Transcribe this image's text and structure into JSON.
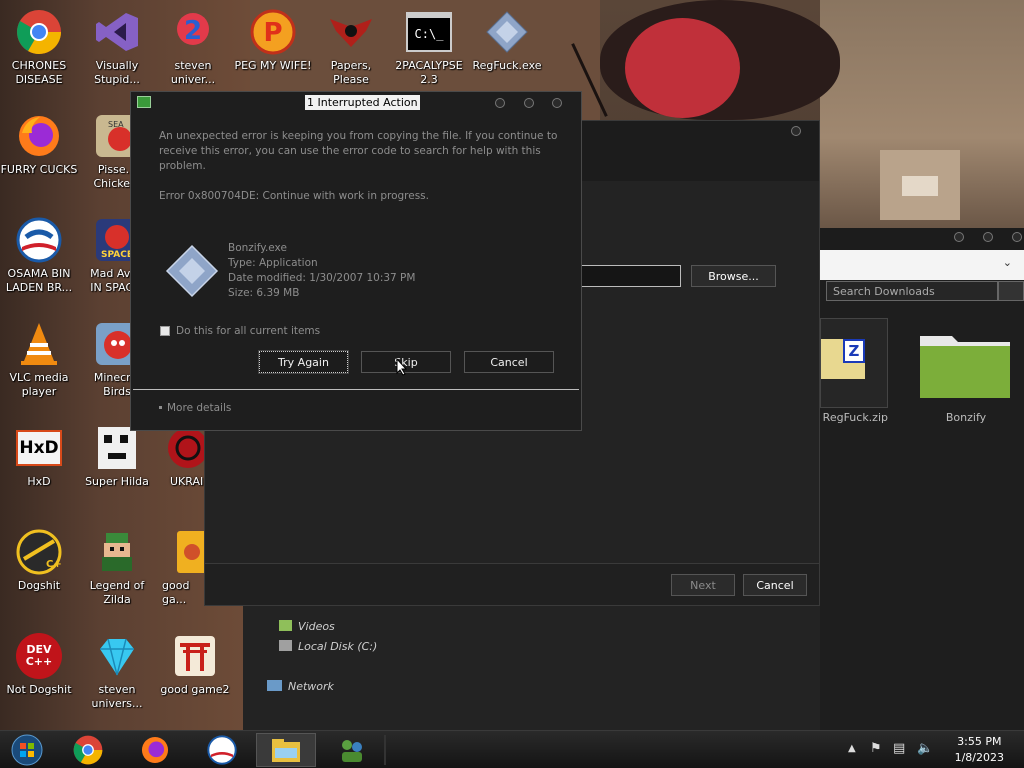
{
  "desktop_icons": [
    {
      "label": "CHRONES\nDISEASE",
      "icon": "chrome-icon"
    },
    {
      "label": "Visually\nStupid...",
      "icon": "visual-studio-icon"
    },
    {
      "label": "steven\nuniver...",
      "icon": "steven-universe-icon"
    },
    {
      "label": "PEG MY WIFE!",
      "icon": "peggle-icon"
    },
    {
      "label": "Papers,\nPlease",
      "icon": "papers-please-icon"
    },
    {
      "label": "2PACALYPSE\n2.3",
      "icon": "cmd-icon",
      "glyph_text": "C:\\_"
    },
    {
      "label": "RegFuck.exe",
      "icon": "regedit-icon"
    },
    {
      "label": "FURRY CUCKS",
      "icon": "firefox-icon"
    },
    {
      "label": "Pisse...\nChicke...",
      "icon": "angry-birds-seasons-icon"
    },
    {
      "label": "OSAMA BIN\nLADEN BR...",
      "icon": "obama-logo-icon"
    },
    {
      "label": "Mad Avi...\nIN SPAC...",
      "icon": "angry-birds-space-icon"
    },
    {
      "label": "VLC media\nplayer",
      "icon": "vlc-icon"
    },
    {
      "label": "Minecr...\nBirds",
      "icon": "angry-birds-icon"
    },
    {
      "label": "HxD",
      "icon": "hxd-icon"
    },
    {
      "label": "Super Hilda",
      "icon": "super-hilda-icon"
    },
    {
      "label": "UKRAI...",
      "icon": "ukraine-icon"
    },
    {
      "label": "Dogshit",
      "icon": "cpp-icon"
    },
    {
      "label": "Legend of\nZilda",
      "icon": "zelda-icon"
    },
    {
      "label": "good ga...",
      "icon": "mahjong-icon"
    },
    {
      "label": "Not Dogshit",
      "icon": "dev-cpp-icon",
      "glyph_text": "DEV\nC++"
    },
    {
      "label": "steven\nunivers...",
      "icon": "diamond-icon"
    },
    {
      "label": "good game2",
      "icon": "torii-icon"
    }
  ],
  "background_window": {
    "browse_label": "Browse...",
    "next_label": "Next",
    "cancel_label": "Cancel"
  },
  "explorer": {
    "search_placeholder": "Search Downloads",
    "files": [
      {
        "name": "RegFuck.zip",
        "icon": "zip-file-icon"
      },
      {
        "name": "Bonzify",
        "icon": "folder-icon"
      }
    ],
    "nav_items": [
      {
        "label": "Videos",
        "icon": "videos-folder-icon"
      },
      {
        "label": "Local Disk (C:)",
        "icon": "local-disk-icon"
      },
      {
        "label": "Network",
        "icon": "network-icon"
      }
    ]
  },
  "dialog": {
    "title": "1 Interrupted Action",
    "message": "An unexpected error is keeping you from copying the file. If you continue to receive this error, you can use the error code to search for help with this problem.",
    "error": "Error 0x800704DE: Continue with work in progress.",
    "file": {
      "name": "Bonzify.exe",
      "type": "Type: Application",
      "modified": "Date modified: 1/30/2007 10:37 PM",
      "size": "Size: 6.39 MB"
    },
    "checkbox_label": "Do this for all current items",
    "try_again_label": "Try Again",
    "skip_label": "Skip",
    "cancel_label": "Cancel",
    "more_details_label": "More details"
  },
  "taskbar": {
    "time": "3:55 PM",
    "date": "1/8/2023",
    "pinned": [
      "windows-orb-icon",
      "chrome-icon",
      "firefox-icon",
      "obama-logo-icon",
      "file-explorer-icon",
      "network-people-icon"
    ]
  },
  "colors": {
    "dialog_bg": "#1e1e1e",
    "dialog_text": "#8d8d8d",
    "taskbar_bg": "#141414"
  }
}
